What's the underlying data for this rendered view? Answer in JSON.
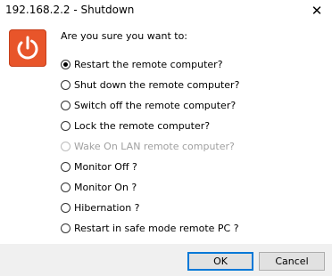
{
  "window": {
    "title": "192.168.2.2 - Shutdown",
    "close_glyph": "✕"
  },
  "dialog": {
    "icon": "power-icon",
    "question": "Are you sure you want to:",
    "options": [
      {
        "label": "Restart the remote computer?",
        "checked": true,
        "disabled": false
      },
      {
        "label": "Shut down the remote computer?",
        "checked": false,
        "disabled": false
      },
      {
        "label": "Switch off the remote computer?",
        "checked": false,
        "disabled": false
      },
      {
        "label": "Lock the remote computer?",
        "checked": false,
        "disabled": false
      },
      {
        "label": "Wake On LAN remote computer?",
        "checked": false,
        "disabled": true
      },
      {
        "label": "Monitor Off ?",
        "checked": false,
        "disabled": false
      },
      {
        "label": "Monitor On ?",
        "checked": false,
        "disabled": false
      },
      {
        "label": "Hibernation ?",
        "checked": false,
        "disabled": false
      },
      {
        "label": "Restart in safe mode remote PC ?",
        "checked": false,
        "disabled": false
      }
    ]
  },
  "buttons": {
    "ok_label": "OK",
    "cancel_label": "Cancel"
  },
  "colors": {
    "icon_background": "#e8552a",
    "default_button_border": "#0078d7"
  }
}
